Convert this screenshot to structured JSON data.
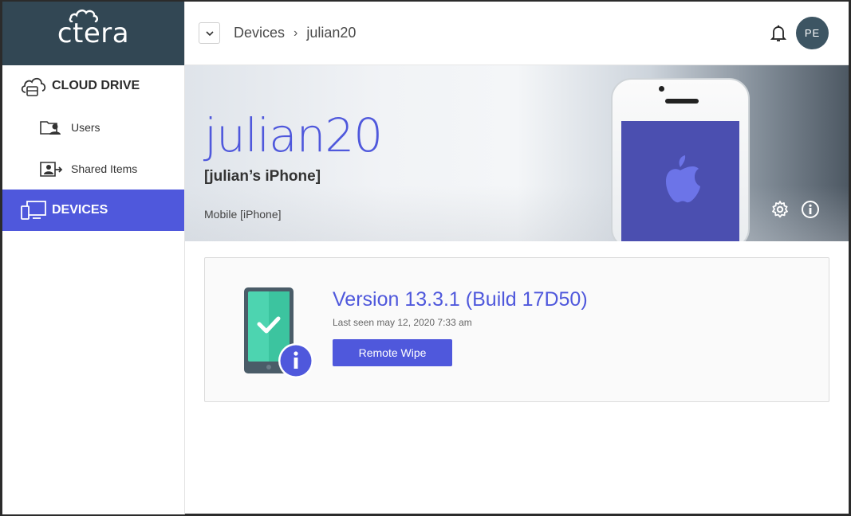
{
  "app": {
    "logo_text": "ctera"
  },
  "sidebar": {
    "items": [
      {
        "label": "CLOUD DRIVE",
        "icon": "cloud-drive-icon"
      },
      {
        "label": "Users",
        "icon": "users-folder-icon"
      },
      {
        "label": "Shared Items",
        "icon": "shared-items-icon"
      },
      {
        "label": "DEVICES",
        "icon": "devices-icon",
        "active": true
      }
    ]
  },
  "header": {
    "breadcrumb": [
      "Devices",
      "julian20"
    ],
    "separator": "›",
    "avatar_initials": "PE"
  },
  "hero": {
    "title": "julian20",
    "subtitle": "[julian’s iPhone]",
    "device_type": "Mobile [iPhone]"
  },
  "device_card": {
    "version": "Version 13.3.1 (Build 17D50)",
    "last_seen": "Last seen may 12, 2020 7:33 am",
    "remote_wipe_label": "Remote Wipe"
  },
  "colors": {
    "accent": "#4f58dc",
    "sidebar_logo_bg": "#324754",
    "avatar_bg": "#3d5563",
    "device_green": "#4dd4b0"
  }
}
